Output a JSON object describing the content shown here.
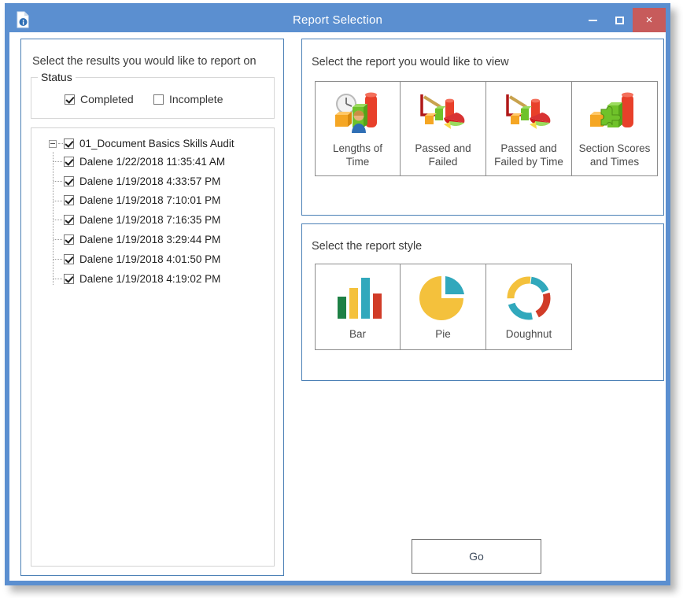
{
  "window": {
    "title": "Report Selection",
    "app_icon": "document-info-icon",
    "buttons": {
      "minimize": "minimize-icon",
      "maximize": "maximize-icon",
      "close": "×"
    },
    "titlebar_color": "#5b8fd0",
    "close_color": "#c75b5b",
    "border_color": "#5b8fd0"
  },
  "left": {
    "caption": "Select the results you would like to report on",
    "status": {
      "legend": "Status",
      "options": [
        {
          "label": "Completed",
          "checked": true
        },
        {
          "label": "Incomplete",
          "checked": false
        }
      ]
    },
    "tree": {
      "root": {
        "label": "01_Document Basics Skills Audit",
        "checked": true,
        "expanded": true
      },
      "children": [
        {
          "label": "Dalene 1/22/2018 11:35:41 AM",
          "checked": true
        },
        {
          "label": "Dalene 1/19/2018 4:33:57 PM",
          "checked": true
        },
        {
          "label": "Dalene 1/19/2018 7:10:01 PM",
          "checked": true
        },
        {
          "label": "Dalene 1/19/2018 7:16:35 PM",
          "checked": true
        },
        {
          "label": "Dalene 1/19/2018 3:29:44 PM",
          "checked": true
        },
        {
          "label": "Dalene 1/19/2018 4:01:50 PM",
          "checked": true
        },
        {
          "label": "Dalene 1/19/2018 4:19:02 PM",
          "checked": true
        }
      ]
    }
  },
  "report": {
    "caption": "Select the report you would like to view",
    "cards": [
      {
        "label": "Lengths of\nTime",
        "icon": "clock-bar-chart-people-icon"
      },
      {
        "label": "Passed and\nFailed",
        "icon": "chart-pencil-pie-icon"
      },
      {
        "label": "Passed and\nFailed by Time",
        "icon": "chart-pencil-pie-icon"
      },
      {
        "label": "Section Scores\nand Times",
        "icon": "bar-chart-puzzle-icon"
      }
    ]
  },
  "style": {
    "caption": "Select the report style",
    "cards": [
      {
        "label": "Bar",
        "icon": "bar-chart-icon"
      },
      {
        "label": "Pie",
        "icon": "pie-chart-icon"
      },
      {
        "label": "Doughnut",
        "icon": "doughnut-chart-icon"
      }
    ],
    "colors": {
      "green": "#1e8045",
      "yellow": "#f4c13c",
      "teal": "#31a8bc",
      "red": "#d13c28"
    }
  },
  "actions": {
    "go_label": "Go"
  }
}
